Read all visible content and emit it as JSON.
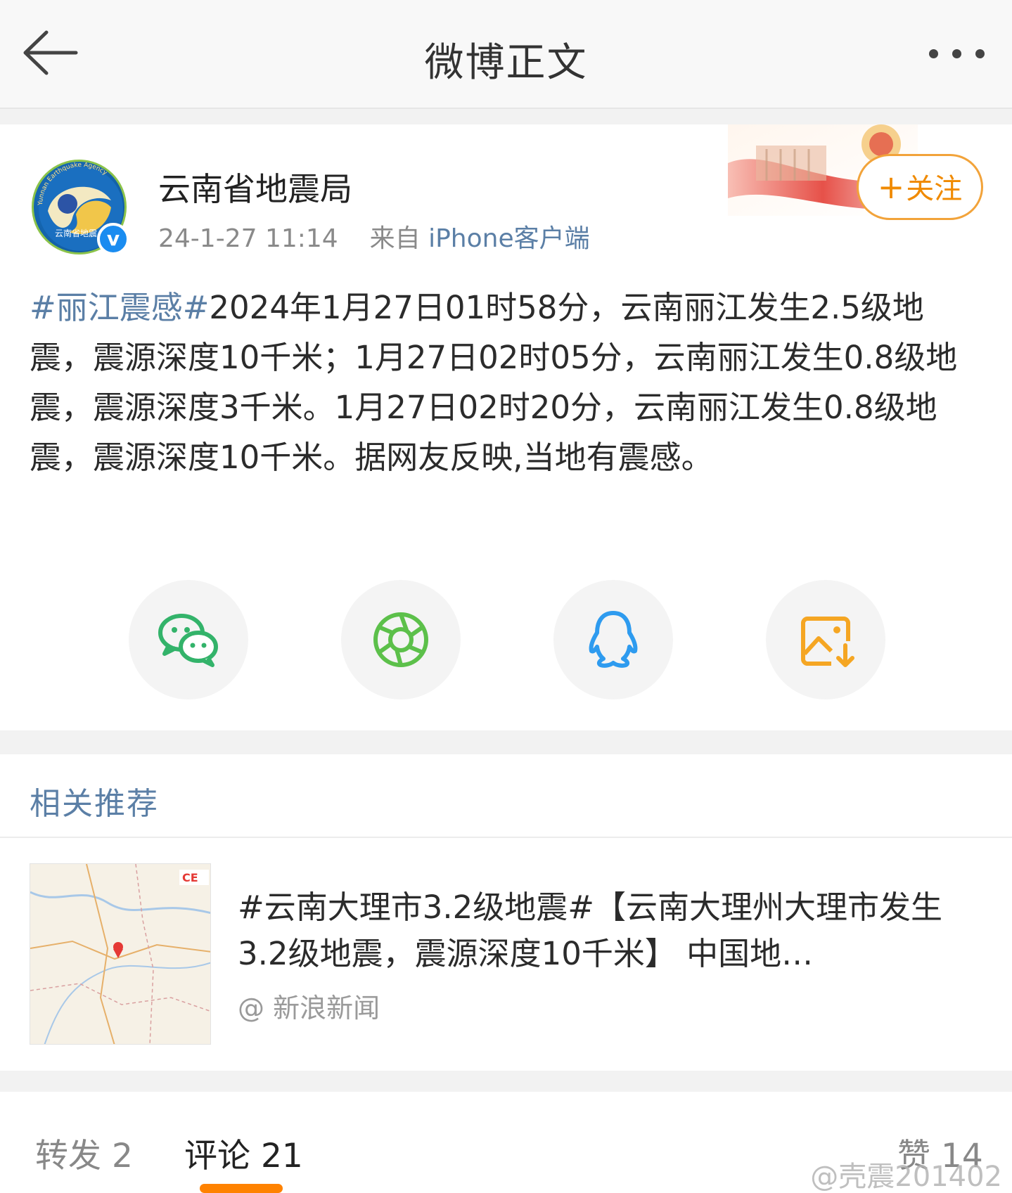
{
  "header": {
    "title": "微博正文",
    "back_icon": "arrow-left-icon",
    "more_icon": "more-dots-icon"
  },
  "post": {
    "username": "云南省地震局",
    "avatar_text": "云南省地震",
    "avatar_caption": "Yunnan Earthquake Agency",
    "timestamp": "24-1-27 11:14",
    "source_prefix": "来自",
    "source": "iPhone客户端",
    "follow_plus": "+",
    "follow_label": "关注",
    "topic": "#丽江震感#",
    "body": "2024年1月27日01时58分，云南丽江发生2.5级地震，震源深度10千米；1月27日02时05分，云南丽江发生0.8级地震，震源深度3千米。1月27日02时20分，云南丽江发生0.8级地震，震源深度10千米。据网友反映,当地有震感。"
  },
  "share": [
    {
      "name": "wechat-icon",
      "color": "#33b36a"
    },
    {
      "name": "moments-icon",
      "color": "#5cc04a"
    },
    {
      "name": "qq-icon",
      "color": "#2e9bef"
    },
    {
      "name": "save-image-icon",
      "color": "#f5a623"
    }
  ],
  "related": {
    "title": "相关推荐",
    "item": {
      "text": "#云南大理市3.2级地震#【云南大理州大理市发生3.2级地震，震源深度10千米】 中国地…",
      "source": "@ 新浪新闻",
      "thumb_badge": "CE"
    }
  },
  "tabs": [
    {
      "label": "转发 2",
      "active": false
    },
    {
      "label": "评论 21",
      "active": true
    },
    {
      "label": "赞 14",
      "active": false
    }
  ],
  "watermark": "@壳震201402",
  "colors": {
    "link": "#5b7fa6",
    "accent": "#ff8200",
    "follow": "#f08a00"
  }
}
